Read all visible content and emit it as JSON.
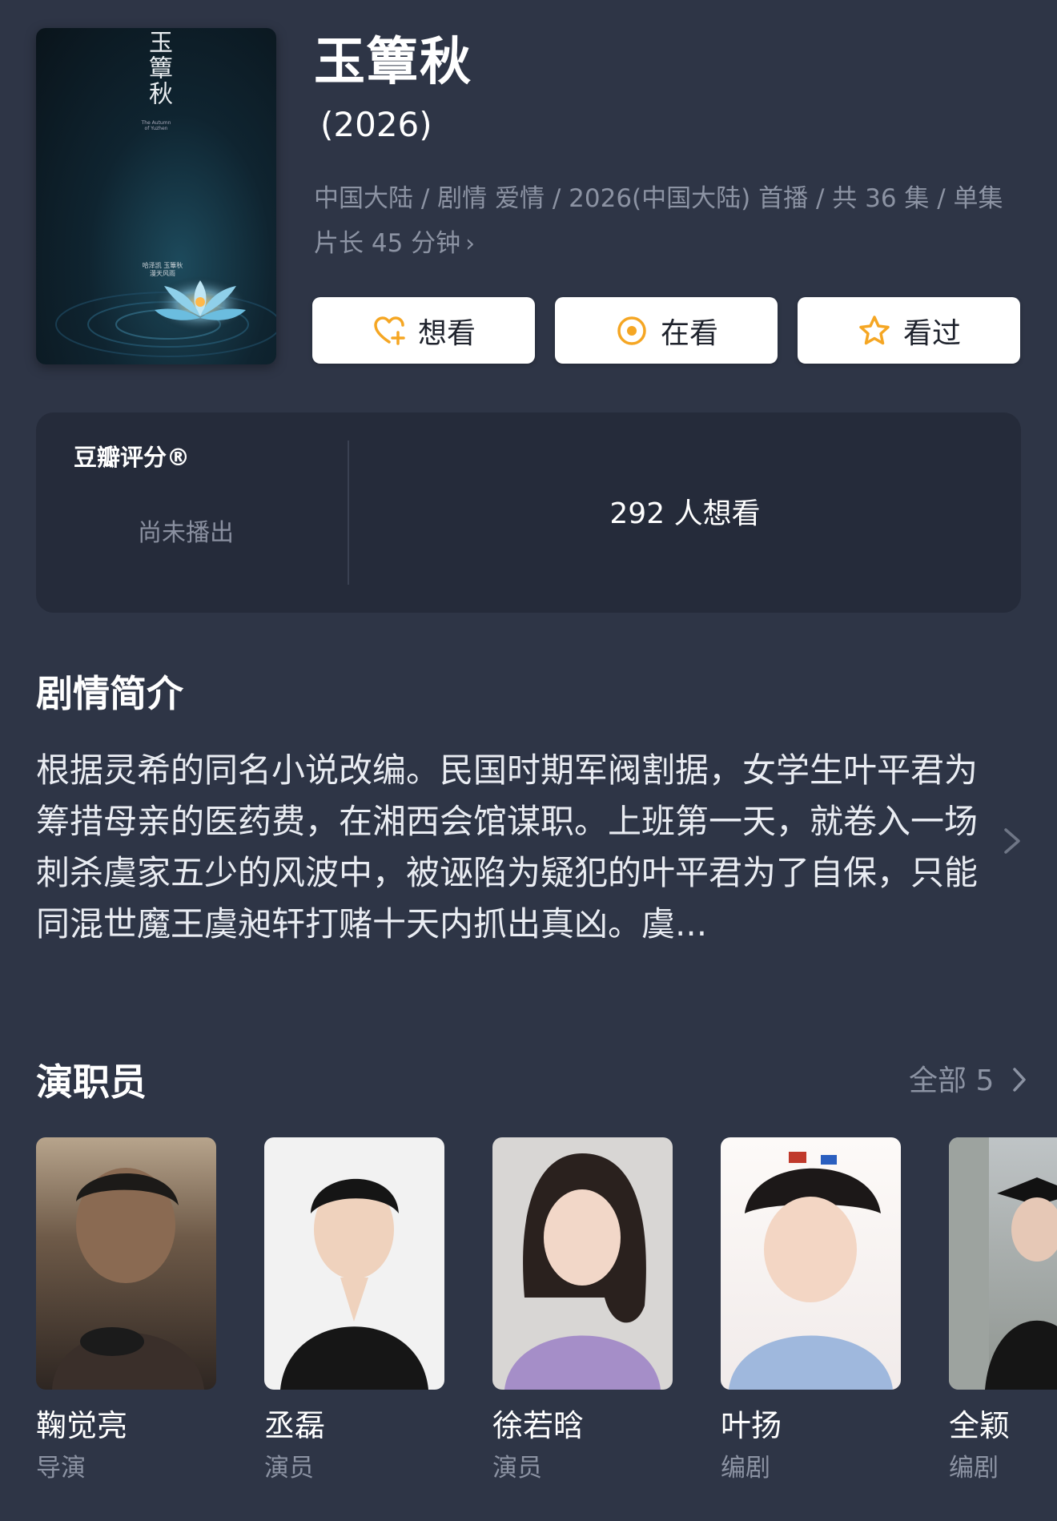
{
  "title": "玉簟秋",
  "year": "(2026)",
  "meta_line": "中国大陆 / 剧情 爱情 / 2026(中国大陆) 首播 / 共 36 集 / 单集片长 45 分钟",
  "poster": {
    "title": "玉簟秋",
    "subtitle": "The Autumn of Yuzhen",
    "credit_line1": "哈泽凯 玉簟秋",
    "credit_line2": "漫天风雨"
  },
  "actions": {
    "want": {
      "label": "想看",
      "icon": "heart-plus-icon"
    },
    "watching": {
      "label": "在看",
      "icon": "target-icon"
    },
    "watched": {
      "label": "看过",
      "icon": "star-icon"
    },
    "accent": "#f5a623"
  },
  "rating": {
    "label": "豆瓣评分®",
    "value": "尚未播出",
    "want_count": "292 人想看"
  },
  "synopsis": {
    "heading": "剧情简介",
    "text": "根据灵希的同名小说改编。民国时期军阀割据，女学生叶平君为筹措母亲的医药费，在湘西会馆谋职。上班第一天，就卷入一场刺杀虞家五少的风波中，被诬陷为疑犯的叶平君为了自保，只能同混世魔王虞昶轩打赌十天内抓出真凶。虞..."
  },
  "cast": {
    "heading": "演职员",
    "all_label": "全部 5",
    "members": [
      {
        "name": "鞠觉亮",
        "role": "导演"
      },
      {
        "name": "丞磊",
        "role": "演员"
      },
      {
        "name": "徐若晗",
        "role": "演员"
      },
      {
        "name": "叶扬",
        "role": "编剧"
      },
      {
        "name": "全颖",
        "role": "编剧"
      }
    ]
  },
  "colors": {
    "background": "#2e3546",
    "card": "#252b3a",
    "muted_text": "#8c93a3"
  }
}
